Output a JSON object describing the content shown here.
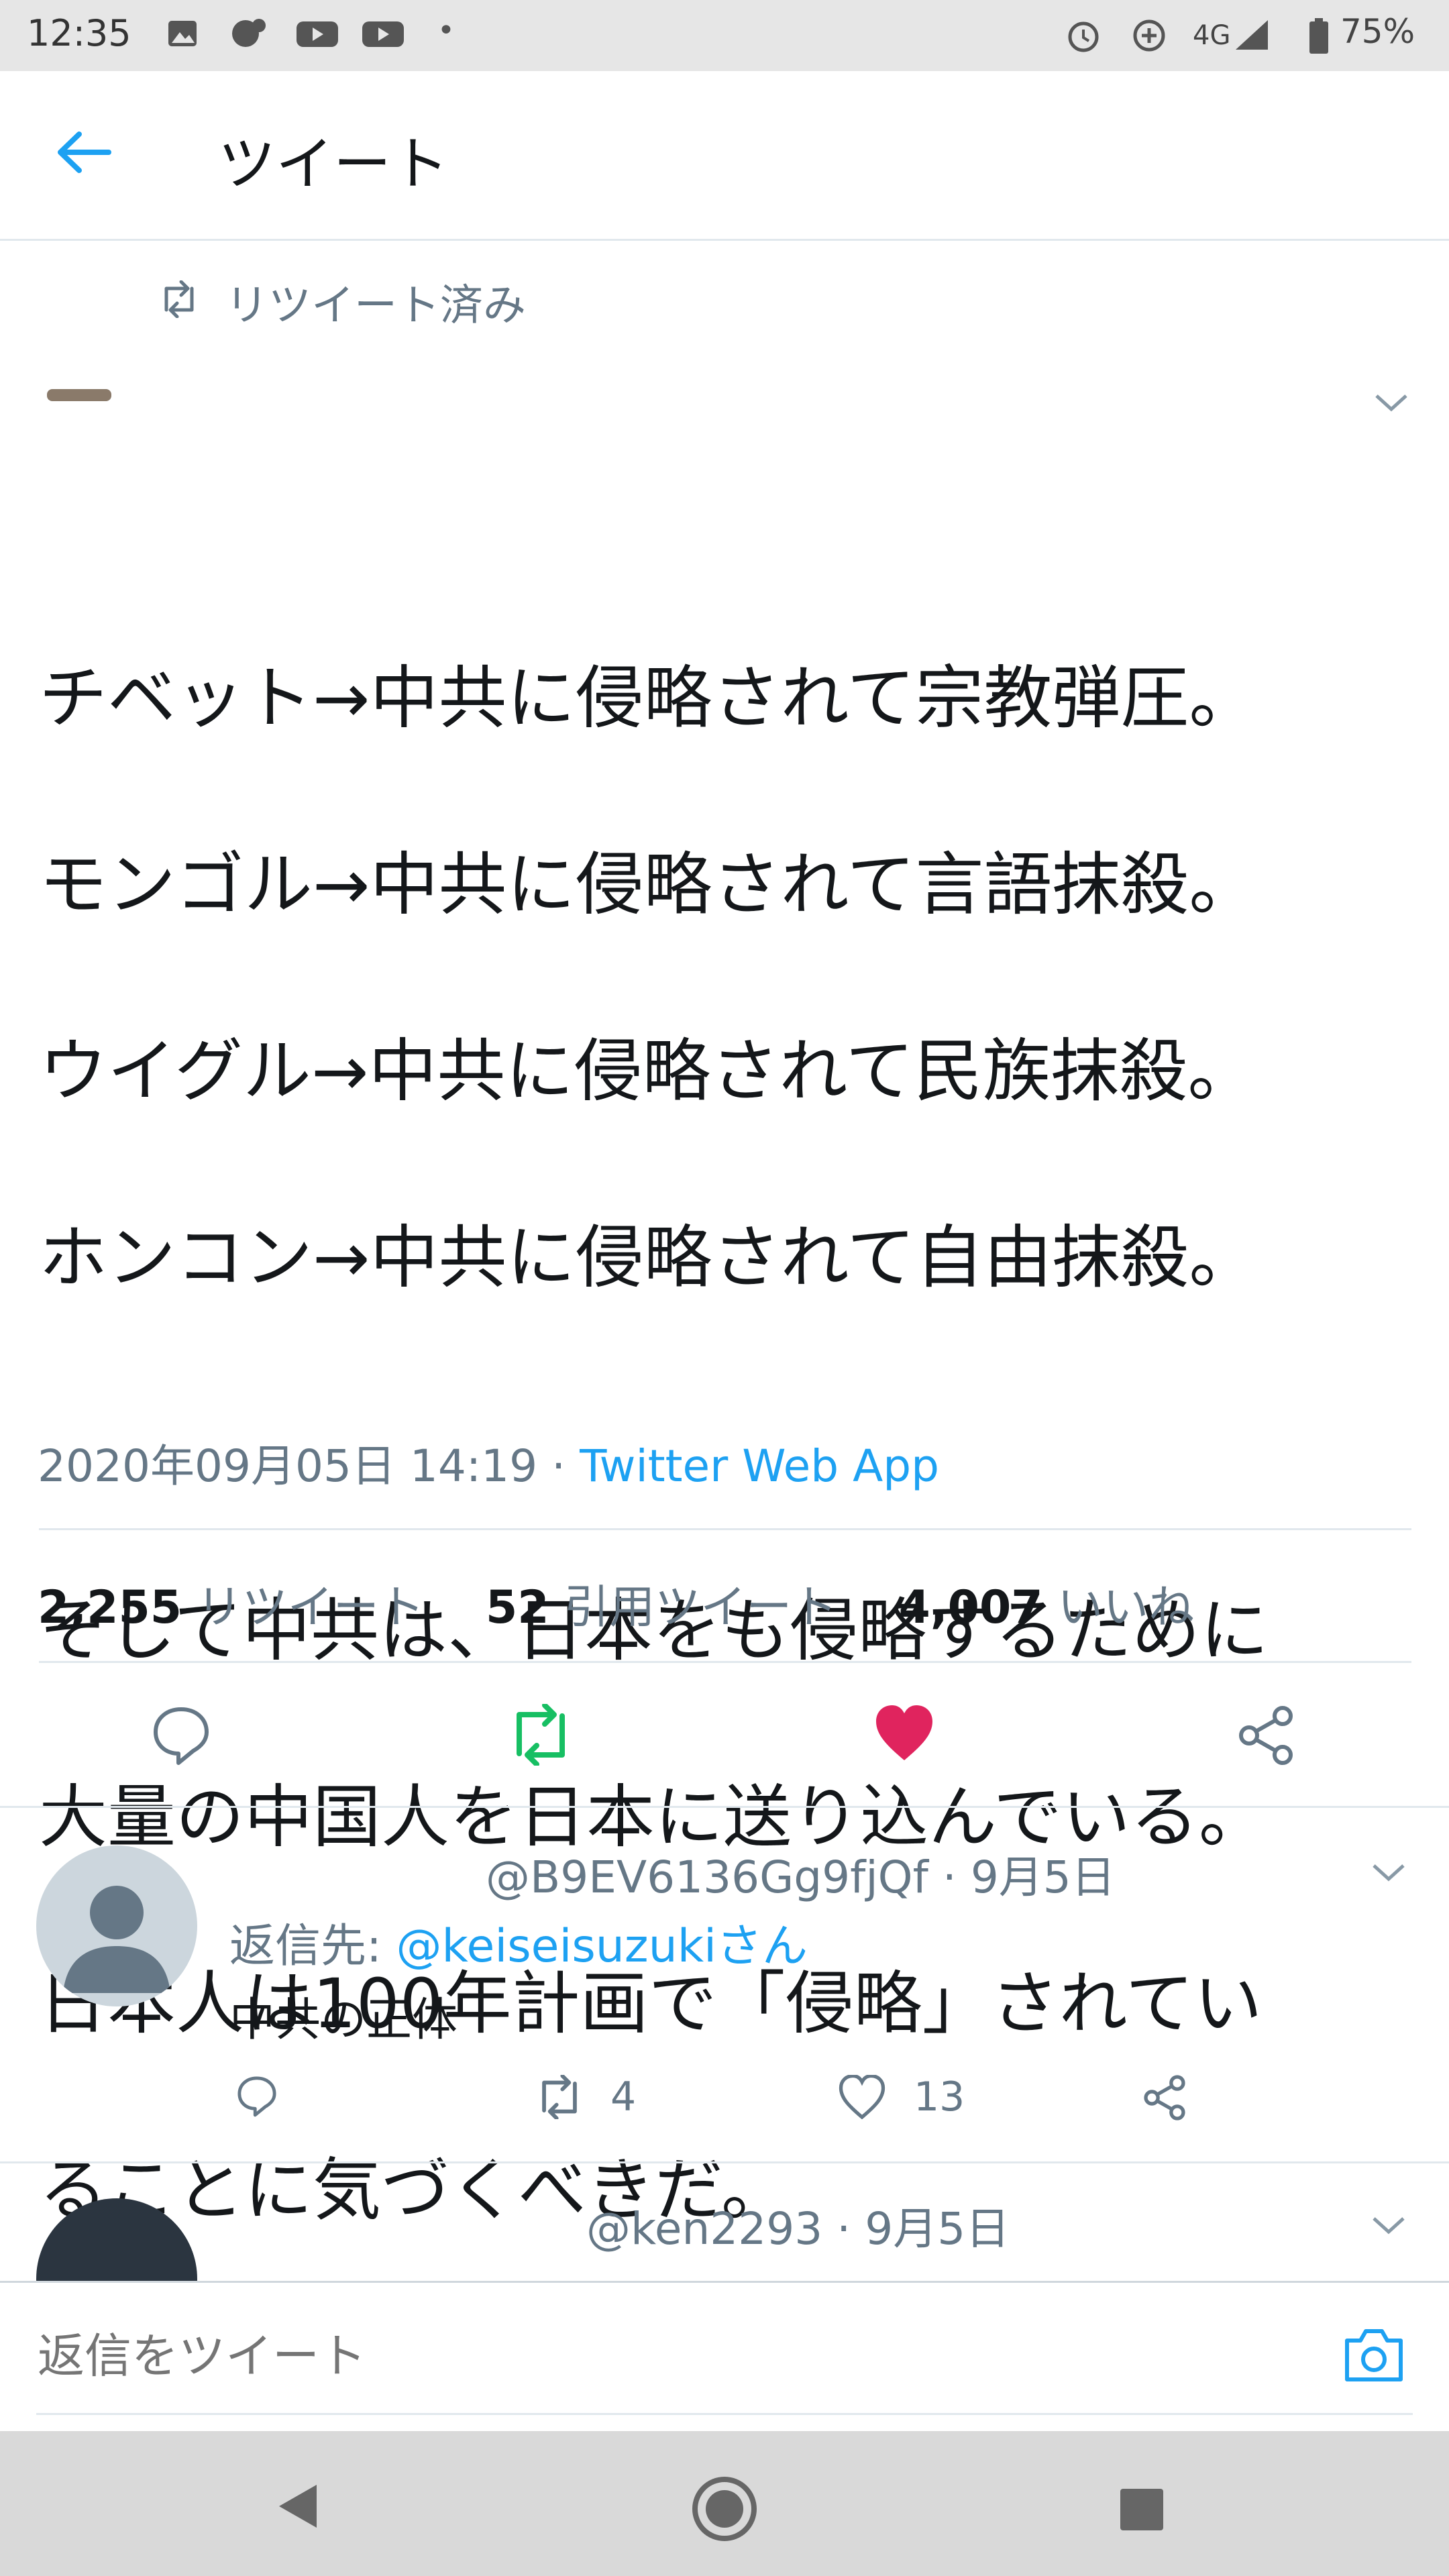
{
  "status_bar": {
    "time": "12:35",
    "dot": "•",
    "network": "4G",
    "battery": "75%"
  },
  "header": {
    "title": "ツイート"
  },
  "retweet_context": {
    "label": "リツイート済み"
  },
  "tweet": {
    "lines": [
      "チベット→中共に侵略されて宗教弾圧。",
      "モンゴル→中共に侵略されて言語抹殺。",
      "ウイグル→中共に侵略されて民族抹殺。",
      "ホンコン→中共に侵略されて自由抹殺。",
      "",
      "そして中共は、日本をも侵略するために",
      "大量の中国人を日本に送り込んでいる。",
      "日本人は100年計画で「侵略」されてい",
      "ることに気づくべきだ。"
    ],
    "timestamp": "2020年09月05日 14:19",
    "separator": "·",
    "source": "Twitter Web App"
  },
  "stats": {
    "retweets_count": "2,255",
    "retweets_label": "リツイート",
    "quotes_count": "52",
    "quotes_label": "引用ツイート",
    "likes_count": "4,007",
    "likes_label": "いいね"
  },
  "replies": [
    {
      "handle": "@B9EV6136Gg9fjQf",
      "date": "· 9月5日",
      "reply_to_prefix": "返信先: ",
      "reply_to_handle": "@keiseisuzukiさん",
      "text": "中共の正体",
      "retweet_count": "4",
      "like_count": "13"
    },
    {
      "handle": "@ken2293",
      "date": "· 9月5日"
    }
  ],
  "composer": {
    "placeholder": "返信をツイート"
  },
  "colors": {
    "accent": "#1da1f2",
    "retweet_green": "#17bf63",
    "like_red": "#e0245e",
    "muted": "#657786"
  }
}
